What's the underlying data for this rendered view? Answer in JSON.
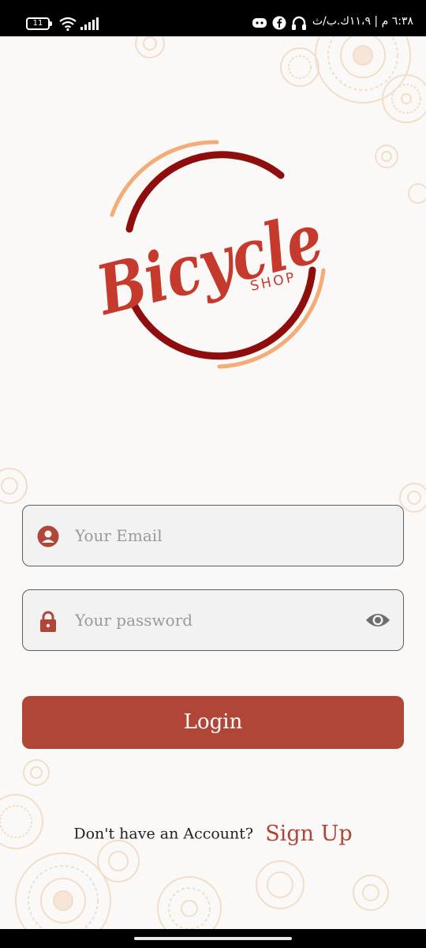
{
  "status_bar": {
    "battery_level": "11",
    "left_icons": [
      "battery-icon",
      "wifi-icon",
      "signal-icon"
    ],
    "right_text": "٦:٣٨ م | ١١،٩ك.ب/ث",
    "right_icons": [
      "headphones-icon",
      "facebook-icon",
      "discord-icon"
    ]
  },
  "logo": {
    "wordmark": "Bicycle",
    "sub_wordmark": "SHOP",
    "colors": {
      "primary": "#c63a2e",
      "dark_ring": "#8e0e0e",
      "light_ring": "#f3ac78"
    }
  },
  "form": {
    "email": {
      "placeholder": "Your Email",
      "value": "",
      "icon": "user-circle-icon"
    },
    "password": {
      "placeholder": "Your password",
      "value": "",
      "icon": "lock-icon",
      "toggle_icon": "eye-icon"
    }
  },
  "login_button": {
    "label": "Login"
  },
  "signup": {
    "prompt": "Don't have an Account?",
    "link": "Sign Up"
  },
  "colors": {
    "accent": "#b04638",
    "background": "#fbf9f7",
    "field_bg": "#f2f2f2"
  }
}
